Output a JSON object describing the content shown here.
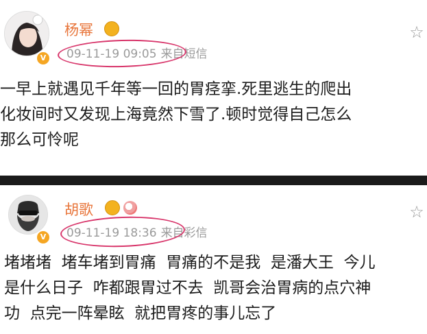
{
  "posts": [
    {
      "author": "杨幂",
      "time": "09-11-19 09:05",
      "source": "来自短信",
      "lines": [
        "一早上就遇见千年等一回的胃痉挛.死里逃生的爬出",
        "化妆间时又发现上海竟然下雪了.顿时觉得自己怎么",
        "那么可怜呢"
      ]
    },
    {
      "author": "胡歌",
      "time": "09-11-19 18:36",
      "source": "来自彩信",
      "lines": [
        "堵堵堵  堵车堵到胃痛  胃痛的不是我  是潘大王  今儿",
        "是什么日子  咋都跟胃过不去  凯哥会治胃病的点穴神",
        "功  点完一阵晕眩  就把胃疼的事儿忘了"
      ]
    }
  ],
  "colors": {
    "name": "#e8753a",
    "meta": "#9a9a9a",
    "highlight_circle": "#d8366b",
    "divider": "#1b1b1b"
  },
  "icons": {
    "verified_badge": "verified-badge-icon",
    "medal": "medal-icon",
    "favorite": "star-outline-icon"
  }
}
